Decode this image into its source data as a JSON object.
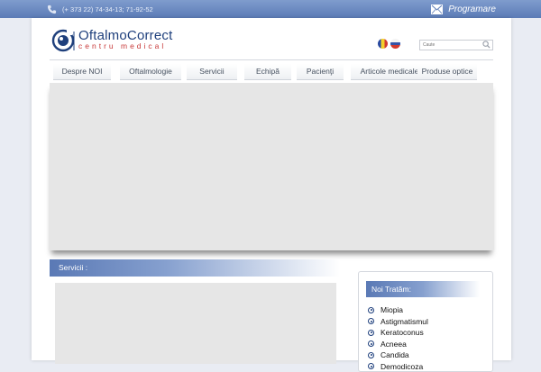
{
  "topbar": {
    "phone": "(+ 373 22) 74-34-13; 71-92-52",
    "appointment_label": "Programare"
  },
  "logo": {
    "name": "OftalmoCorrect",
    "subtitle": "centru medical"
  },
  "search": {
    "placeholder": "Caute"
  },
  "nav": {
    "items": [
      {
        "label": "Despre NOI"
      },
      {
        "label": "Oftalmologie"
      },
      {
        "label": "Servicii"
      },
      {
        "label": "Echipă"
      },
      {
        "label": "Pacienţi"
      },
      {
        "label": "Articole medicale"
      },
      {
        "label": "Produse optice"
      }
    ]
  },
  "servicii": {
    "title": "Servicii :"
  },
  "sidebar": {
    "title": "Noi Tratăm:",
    "items": [
      {
        "label": "Miopia"
      },
      {
        "label": "Astigmatismul"
      },
      {
        "label": "Keratoconus"
      },
      {
        "label": "Acneea"
      },
      {
        "label": "Candida"
      },
      {
        "label": "Demodicoza"
      }
    ]
  },
  "colors": {
    "topbar": "#5b7bb6",
    "brand": "#1e3f7c",
    "accent_red": "#c83a3a"
  }
}
